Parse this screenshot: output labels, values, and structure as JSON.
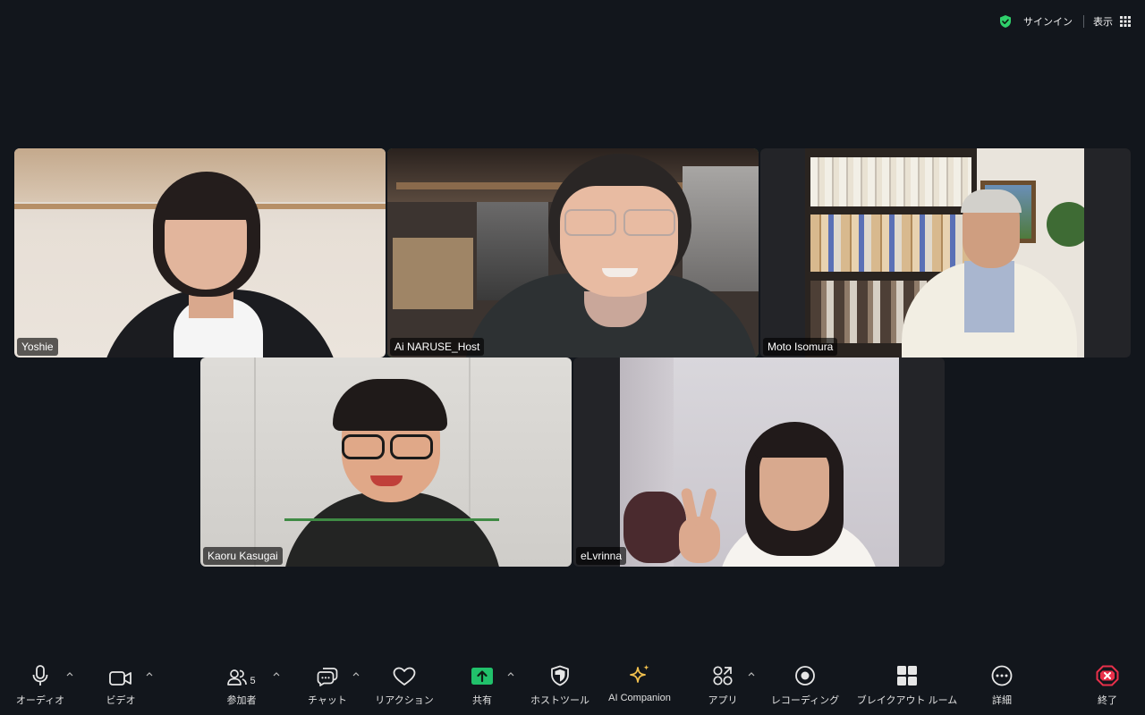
{
  "topbar": {
    "signin_label": "サインイン",
    "view_label": "表示",
    "shield_color": "#2fd06b"
  },
  "participants": [
    {
      "name": "Yoshie",
      "active": false
    },
    {
      "name": "Ai NARUSE_Host",
      "active": true
    },
    {
      "name": "Moto Isomura",
      "active": false
    },
    {
      "name": "Kaoru Kasugai",
      "active": false
    },
    {
      "name": "eLvrinna",
      "active": false
    }
  ],
  "toolbar": {
    "audio": {
      "label": "オーディオ",
      "icon": "microphone-icon"
    },
    "video": {
      "label": "ビデオ",
      "icon": "video-camera-icon"
    },
    "participants": {
      "label": "参加者",
      "count": "5",
      "icon": "participants-icon"
    },
    "chat": {
      "label": "チャット",
      "icon": "chat-icon"
    },
    "reactions": {
      "label": "リアクション",
      "icon": "heart-icon"
    },
    "share": {
      "label": "共有",
      "icon": "share-screen-icon",
      "color": "#21c16b"
    },
    "host_tools": {
      "label": "ホストツール",
      "icon": "shield-icon"
    },
    "ai_companion": {
      "label": "AI Companion",
      "icon": "sparkle-icon",
      "color": "#f2c14e"
    },
    "apps": {
      "label": "アプリ",
      "icon": "apps-icon"
    },
    "recording": {
      "label": "レコーディング",
      "icon": "record-icon"
    },
    "breakout": {
      "label": "ブレイクアウト ルーム",
      "icon": "breakout-rooms-icon"
    },
    "more": {
      "label": "詳細",
      "icon": "more-icon"
    },
    "end": {
      "label": "終了",
      "icon": "end-meeting-icon",
      "color": "#e8304a"
    }
  }
}
